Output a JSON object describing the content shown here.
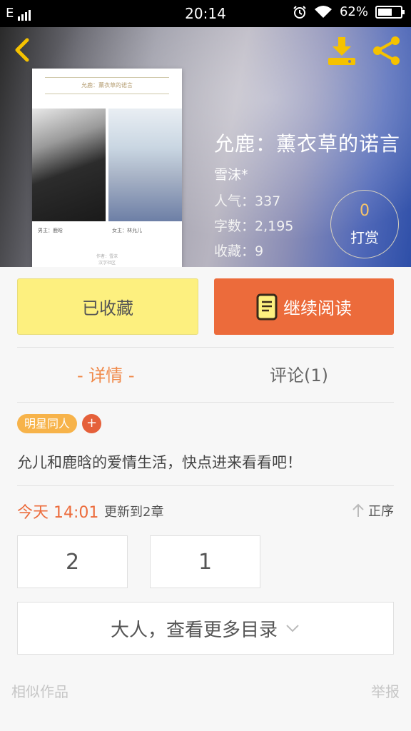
{
  "status_bar": {
    "network": "E",
    "time": "20:14",
    "battery": "62%"
  },
  "header": {
    "cover": {
      "caption": "允鹿：薰衣草的诺言",
      "male_lead": "男主：鹿晗",
      "female_lead": "女主：林允儿",
      "footer_author": "作者：雪沫",
      "footer_site": "汉字社区"
    },
    "title": "允鹿：薰衣草的诺言",
    "author": "雪沫*",
    "stats": {
      "popularity": "人气：337",
      "word_count": "字数：2,195",
      "favorites": "收藏：9"
    },
    "reward": {
      "count": "0",
      "label": "打赏"
    }
  },
  "actions": {
    "favorited_label": "已收藏",
    "continue_label": "继续阅读"
  },
  "tabs": {
    "detail": "- 详情 -",
    "comments": "评论(1)"
  },
  "tag": {
    "label": "明星同人",
    "add": "+"
  },
  "description": "允儿和鹿晗的爱情生活，快点进来看看吧！",
  "update": {
    "time": "今天 14:01",
    "text": "更新到2章",
    "sort_label": "正序"
  },
  "chapters": [
    "2",
    "1"
  ],
  "more_catalog": "大人，查看更多目录",
  "footer": {
    "similar": "相似作品",
    "report": "举报"
  },
  "colors": {
    "accent": "#ec6b3b",
    "favorite_bg": "#fdf07f",
    "tag": "#f7b34a",
    "reward_num": "#f6c46a"
  },
  "icons": {
    "back": "chevron-left-icon",
    "download": "download-icon",
    "share": "share-icon",
    "book": "book-icon",
    "sort": "arrow-up-icon",
    "more": "chevron-down-icon"
  }
}
